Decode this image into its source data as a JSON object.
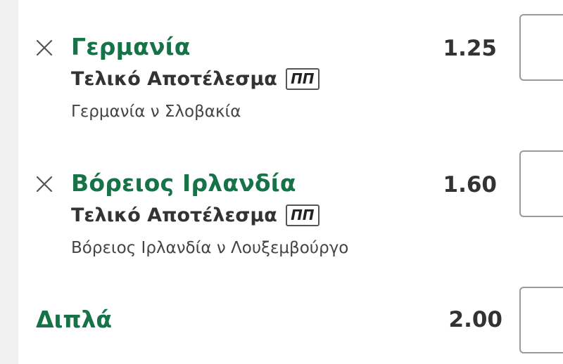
{
  "selections": [
    {
      "name": "Γερμανία",
      "market": "Τελικό Αποτέλεσμα",
      "badge": "ΠΠ",
      "event": "Γερμανία ν Σλοβακία",
      "odds": "1.25"
    },
    {
      "name": "Βόρειος Ιρλανδία",
      "market": "Τελικό Αποτέλεσμα",
      "badge": "ΠΠ",
      "event": "Βόρειος Ιρλανδία ν Λουξεμβούργο",
      "odds": "1.60"
    }
  ],
  "multiple": {
    "label": "Διπλά",
    "odds": "2.00"
  },
  "colors": {
    "accent_green": "#157347",
    "text_dark": "#333333",
    "border_gray": "#9a9a9a"
  }
}
